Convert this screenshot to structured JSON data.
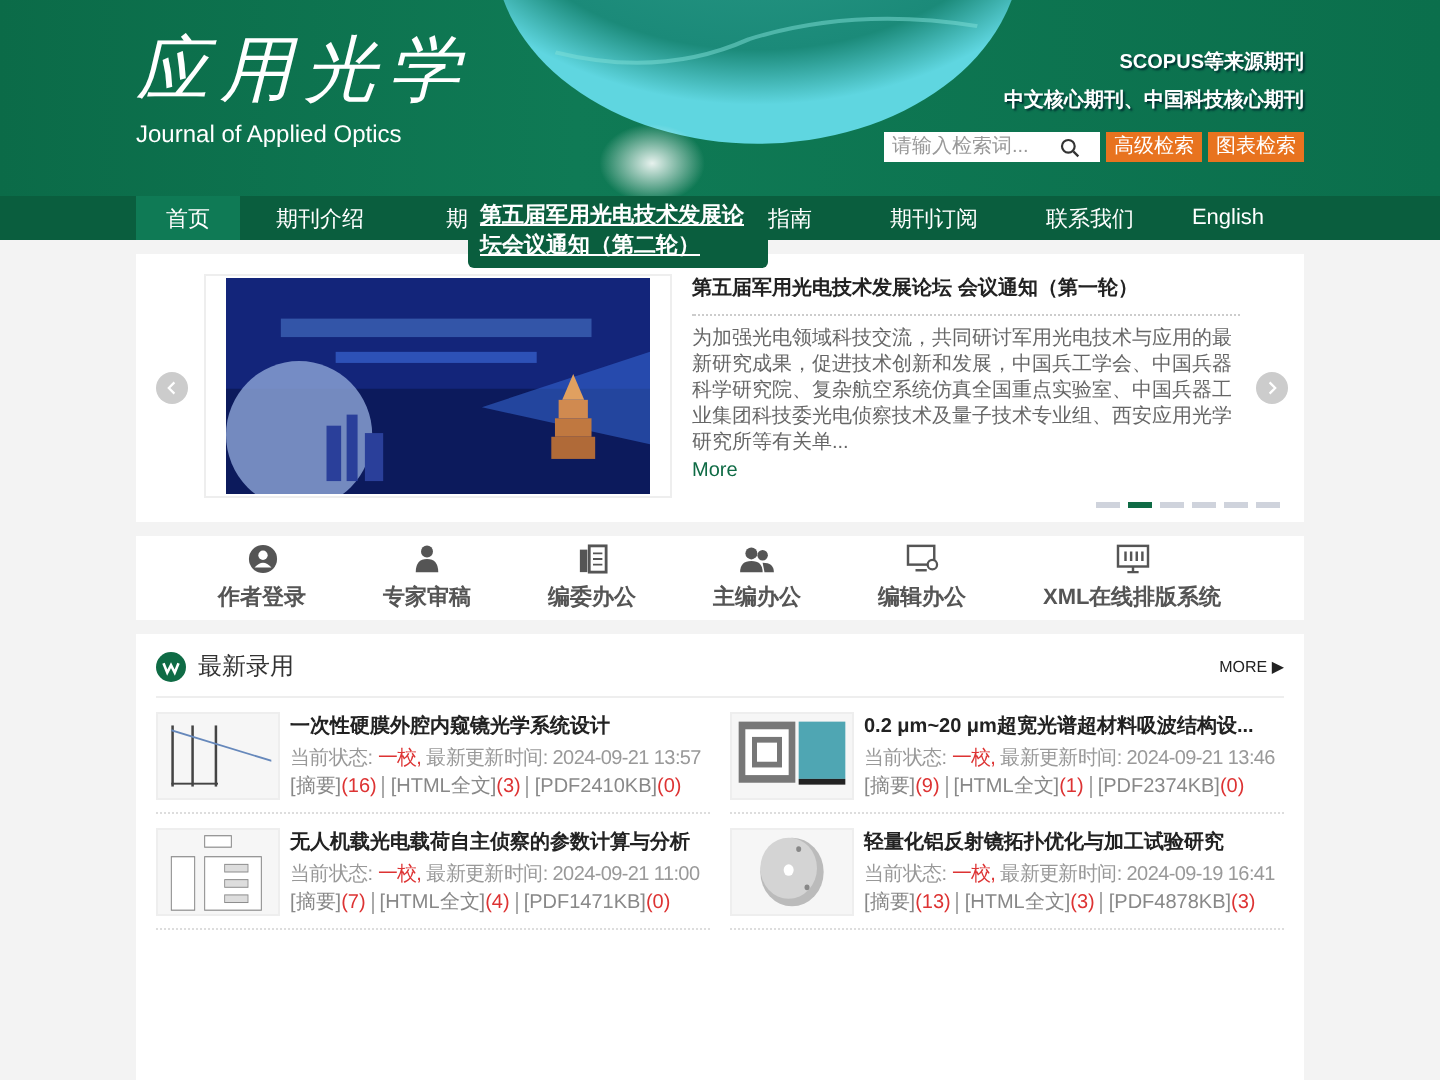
{
  "header": {
    "logo": "应用光学",
    "logo_subtitle": "Journal of Applied Optics",
    "badges": [
      "SCOPUS等来源期刊",
      "中文核心期刊、中国科技核心期刊"
    ],
    "search": {
      "placeholder": "请输入检索词..."
    },
    "buttons": [
      "高级检索",
      "图表检索"
    ]
  },
  "nav": [
    {
      "label": "首页",
      "selected": true
    },
    {
      "label": "期刊介绍",
      "selected": false
    },
    {
      "label": "期",
      "selected": false
    },
    {
      "label": "指南",
      "selected": false
    },
    {
      "label": "期刊订阅",
      "selected": false
    },
    {
      "label": "联系我们",
      "selected": false
    },
    {
      "label": "English",
      "selected": false
    }
  ],
  "notice_popup": {
    "text": "第五届军用光电技术发展论坛会议通知（第二轮）"
  },
  "slider": {
    "title": "第五届军用光电技术发展论坛 会议通知（第一轮）",
    "summary": "为加强光电领域科技交流，共同研讨军用光电技术与应用的最新研究成果，促进技术创新和发展，中国兵工学会、中国兵器科学研究院、复杂航空系统仿真全国重点实验室、中国兵器工业集团科技委光电侦察技术及量子技术专业组、西安应用光学研究所等有关单...",
    "more": "More",
    "dots": [
      {
        "selected": false
      },
      {
        "selected": true
      },
      {
        "selected": false
      },
      {
        "selected": false
      },
      {
        "selected": false
      },
      {
        "selected": false
      }
    ]
  },
  "quick_links": [
    {
      "label": "作者登录",
      "kind": "author"
    },
    {
      "label": "专家审稿",
      "kind": "expert"
    },
    {
      "label": "编委办公",
      "kind": "board"
    },
    {
      "label": "主编办公",
      "kind": "chief"
    },
    {
      "label": "编辑办公",
      "kind": "editor"
    },
    {
      "label": "XML在线排版系统",
      "kind": "xml"
    }
  ],
  "latest": {
    "title": "最新录用",
    "more": "MORE ▶",
    "articles": [
      {
        "title": "一次性硬膜外腔内窥镜光学系统设计",
        "status_prefix": "当前状态: ",
        "status": "一校,",
        "updated": " 最新更新时间: 2024-09-21 13:57",
        "links": [
          {
            "label": "[摘要]",
            "count": "(16)"
          },
          {
            "label": "[HTML全文]",
            "count": "(3)"
          },
          {
            "label": "[PDF2410KB]",
            "count": "(0)"
          }
        ]
      },
      {
        "title": "0.2 μm~20 μm超宽光谱超材料吸波结构设...",
        "status_prefix": "当前状态: ",
        "status": "一校,",
        "updated": " 最新更新时间: 2024-09-21 13:46",
        "links": [
          {
            "label": "[摘要]",
            "count": "(9)"
          },
          {
            "label": "[HTML全文]",
            "count": "(1)"
          },
          {
            "label": "[PDF2374KB]",
            "count": "(0)"
          }
        ]
      },
      {
        "title": "无人机载光电载荷自主侦察的参数计算与分析",
        "status_prefix": "当前状态: ",
        "status": "一校,",
        "updated": " 最新更新时间: 2024-09-21 11:00",
        "links": [
          {
            "label": "[摘要]",
            "count": "(7)"
          },
          {
            "label": "[HTML全文]",
            "count": "(4)"
          },
          {
            "label": "[PDF1471KB]",
            "count": "(0)"
          }
        ]
      },
      {
        "title": "轻量化铝反射镜拓扑优化与加工试验研究",
        "status_prefix": "当前状态: ",
        "status": "一校,",
        "updated": " 最新更新时间: 2024-09-19 16:41",
        "links": [
          {
            "label": "[摘要]",
            "count": "(13)"
          },
          {
            "label": "[HTML全文]",
            "count": "(3)"
          },
          {
            "label": "[PDF4878KB]",
            "count": "(3)"
          }
        ]
      }
    ]
  }
}
